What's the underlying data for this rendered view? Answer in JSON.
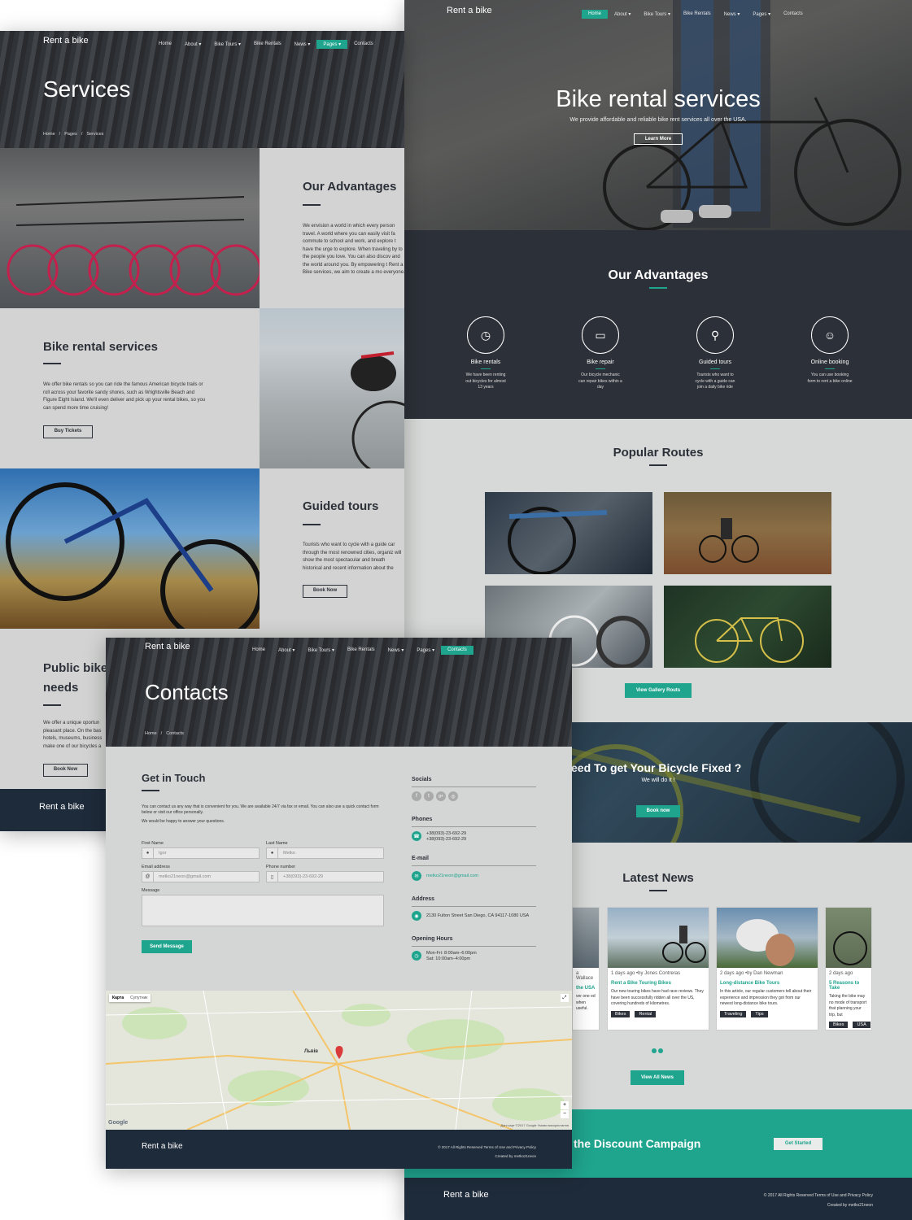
{
  "brand": "Rent a bike",
  "nav": {
    "home": "Home",
    "about": "About",
    "bike_tours": "Bike Tours",
    "bike_rentals": "Bike Rentals",
    "news": "News",
    "pages": "Pages",
    "contacts": "Contacts",
    "caret": "▾"
  },
  "home": {
    "hero_title": "Bike rental services",
    "hero_sub": "We provide affordable and reliable bike rent services all over the USA.",
    "learn_more": "Learn More",
    "advantages_title": "Our Advantages",
    "advantages": [
      {
        "title": "Bike rentals",
        "text": "We have been renting out bicycles for almost 13 years",
        "icon": "clock-icon"
      },
      {
        "title": "Bike repair",
        "text": "Our bicycle mechanic can repair bikes within a day",
        "icon": "card-icon"
      },
      {
        "title": "Guided tours",
        "text": "Tourists who want to cycle with a guide can join a daily bike ride",
        "icon": "bicycle-icon"
      },
      {
        "title": "Online booking",
        "text": "You can use booking form to rent a bike online",
        "icon": "smile-icon"
      }
    ],
    "routes_title": "Popular Routes",
    "gallery_btn": "View Gallery Routs",
    "fixed_title": "eed To get Your Bicycle Fixed ?",
    "fixed_sub": "We will do it !",
    "book_now": "Book now",
    "news_title": "Latest News",
    "news": [
      {
        "meta": "a Wallace",
        "title": "the USA",
        "excerpt": "ver one ed when useful.",
        "tags": []
      },
      {
        "meta": "1 days ago   •by Jones Contreras",
        "title": "Rent a Bike Touring Bikes",
        "excerpt": "Our new touring bikes have had rave reviews. They have been successfully ridden all over the US, covering hundreds of kilometres.",
        "tags": [
          "Bikes",
          "Rental"
        ]
      },
      {
        "meta": "2 days ago   •by Dan Newman",
        "title": "Long-distance Bike Tours",
        "excerpt": "In this article, our regular customers tell about their experience and impression they got from our newest long-distance bike tours.",
        "tags": [
          "Traveling",
          "Tips"
        ]
      },
      {
        "meta": "2 days ago",
        "title": "5 Reasons to Take",
        "excerpt": "Taking the bike may no mode of transport that planning your trip, but",
        "tags": [
          "Bikes",
          "USA"
        ]
      }
    ],
    "all_news": "View All News",
    "campaign": "the Discount Campaign",
    "get_started": "Get Started",
    "copyright": "© 2017 All Rights Reserved Terms of Use and Privacy Policy",
    "created": "Created by metko21neon"
  },
  "services": {
    "title": "Services",
    "crumb_home": "Home",
    "crumb_pages": "Pages",
    "crumb_current": "Services",
    "sep": "/",
    "adv_title": "Our Advantages",
    "adv_text": "We envision a world in which every person travel. A world where you can easily visit fa commute to school and work, and explore t have the urge to explore. When traveling by to the people you love. You can also discov and the world around you. By empowering t Rent a Bike services, we aim to create a mo everyone.",
    "rental_title": "Bike rental services",
    "rental_text": "We offer bike rentals so you can ride the famous American bicycle trails or roll across your favorite sandy shores, such as Wrightsville Beach and Figure Eight Island. We'll even deliver and pick up your rental bikes, so you can spend more time cruising!",
    "buy_tickets": "Buy Tickets",
    "tours_title": "Guided tours",
    "tours_text": "Tourists who want to cycle with a guide car through the most renowned cities, organiz will show the most spectacular and breath historical and recent information about the",
    "book_now": "Book Now",
    "public_title": "Public bike needs",
    "public_text": "We offer a unique oportun pleasant place. On the bas hotels, museums, business make one of our bicycles a",
    "public_btn": "Book Now"
  },
  "contacts": {
    "title": "Contacts",
    "crumb_home": "Home",
    "crumb_current": "Contacts",
    "sep": "/",
    "git_title": "Get in Touch",
    "git_text": "You can contact us any way that is convenient for you. We are available 24/7 via fax or email. You can also use a quick contact form below or visit our office personally.",
    "git_text2": "We would be happy to answer your questions.",
    "first_name_label": "First Name",
    "first_name": "Igor",
    "last_name_label": "Last Name",
    "last_name": "Metko",
    "email_label": "Email address",
    "email": "metko21neon@gmail.com",
    "phone_label": "Phone number",
    "phone": "+38(093)-23-692-29",
    "message_label": "Message",
    "send": "Send Message",
    "socials": "Socials",
    "phones": "Phones",
    "phone1": "+38(093)-23-692-29",
    "phone2": "+38(093)-23-692-29",
    "email_head": "E-mail",
    "email_val": "metko21neon@gmail.com",
    "address_head": "Address",
    "address_val": "2130 Fulton Street San Diego, CA 94117-1080 USA",
    "hours_head": "Opening Hours",
    "hours1": "Mon-Fri: 8:00am–6:00pm",
    "hours2": "Sat: 10:00am–4:00pm",
    "map_tab1": "Карта",
    "map_tab2": "Супутник",
    "map_city": "Львів",
    "map_google": "Google",
    "map_footer": "Дані карт ©2017 Google   Умови використання",
    "copyright": "© 2017 All Rights Reserved Terms of Use and Privacy Policy",
    "created": "Created by metko21neon"
  },
  "colors": {
    "accent": "#1fa48d",
    "dark": "#2c3038",
    "footer": "#1e2b3a",
    "light_bg": "#d7d9d8"
  }
}
